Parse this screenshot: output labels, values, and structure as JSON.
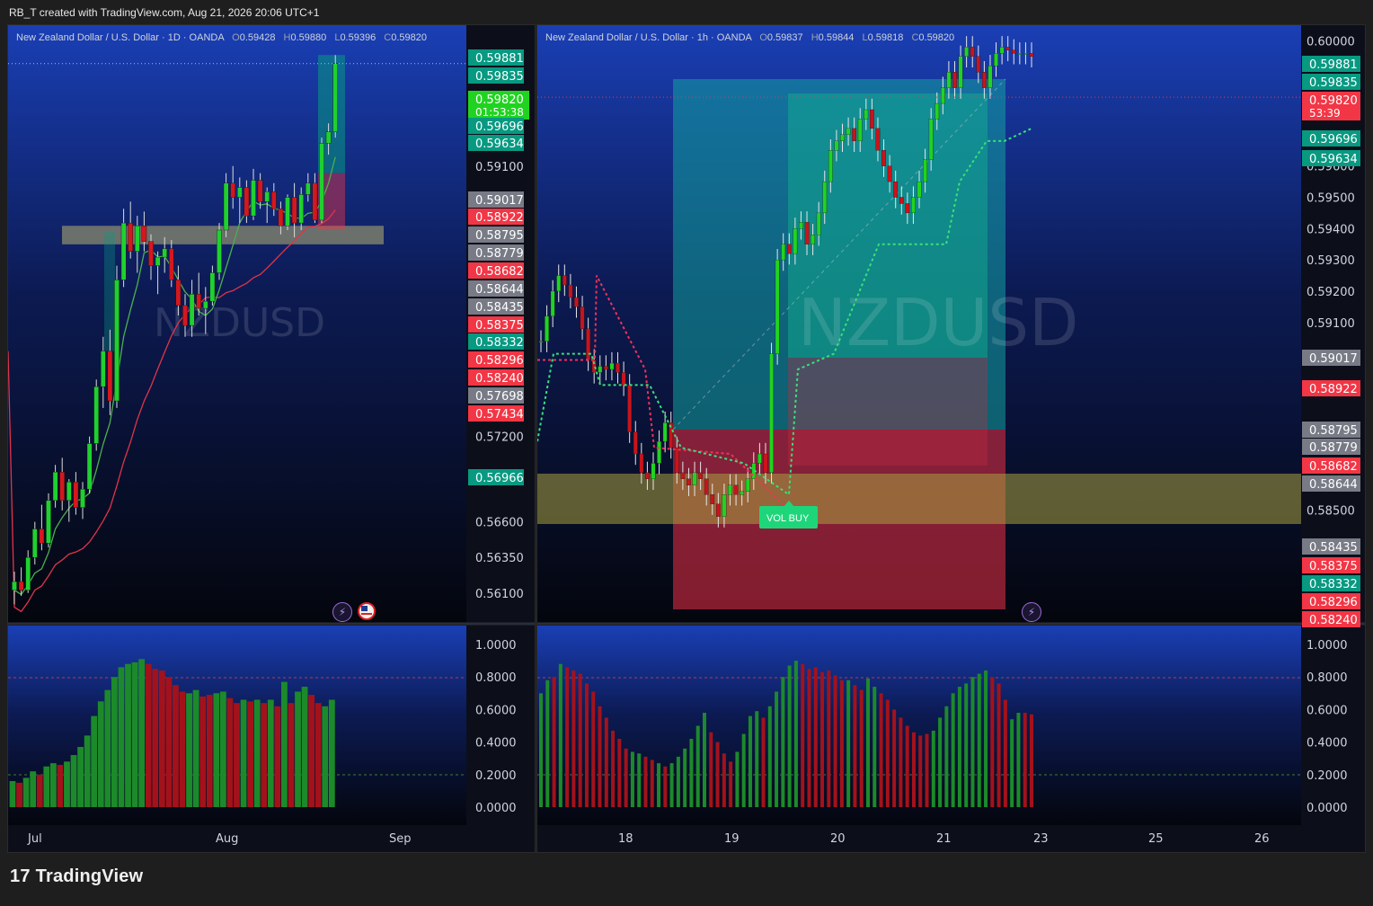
{
  "caption": "RB_T created with TradingView.com, Aug 21, 2026 20:06 UTC+1",
  "brand": {
    "name": "TradingView",
    "logo_icon": "tradingview-logo-icon"
  },
  "colors": {
    "up": "#1fd12f",
    "down": "#d5171e",
    "teal": "#089981",
    "red_label": "#f23645",
    "gray_label": "#787b86",
    "bg_top": "#1538a8",
    "bg_bottom": "#05070e"
  },
  "chart_data": [
    {
      "type": "candlestick",
      "pane": "left",
      "legend": {
        "symbol": "New Zealand Dollar / U.S. Dollar · 1D · OANDA",
        "o": "0.59428",
        "h": "0.59880",
        "l": "0.59396",
        "c": "0.59820"
      },
      "watermark": "NZDUSD",
      "ylim": [
        0.5589,
        0.6009
      ],
      "y_ticks": [
        "0.59100",
        "0.57200",
        "0.56600",
        "0.56350",
        "0.56100"
      ],
      "price_labels": [
        {
          "v": "0.59881",
          "kind": "teal"
        },
        {
          "v": "0.59835",
          "kind": "teal"
        },
        {
          "v": "0.59820",
          "kind": "current",
          "sub": "01:53:38"
        },
        {
          "v": "0.59696",
          "kind": "teal"
        },
        {
          "v": "0.59634",
          "kind": "teal"
        },
        {
          "v": "0.59017",
          "kind": "gray"
        },
        {
          "v": "0.58922",
          "kind": "red"
        },
        {
          "v": "0.58795",
          "kind": "gray"
        },
        {
          "v": "0.58779",
          "kind": "gray"
        },
        {
          "v": "0.58682",
          "kind": "red"
        },
        {
          "v": "0.58644",
          "kind": "gray"
        },
        {
          "v": "0.58435",
          "kind": "gray"
        },
        {
          "v": "0.58375",
          "kind": "red"
        },
        {
          "v": "0.58332",
          "kind": "teal"
        },
        {
          "v": "0.58296",
          "kind": "red"
        },
        {
          "v": "0.58240",
          "kind": "red"
        },
        {
          "v": "0.57698",
          "kind": "gray"
        },
        {
          "v": "0.57434",
          "kind": "red"
        },
        {
          "v": "0.56966",
          "kind": "teal"
        }
      ],
      "x_labels": [
        "Jul",
        "Aug",
        "Sep"
      ],
      "candles": [
        [
          0.5612,
          0.5625,
          0.5602,
          0.5618
        ],
        [
          0.5618,
          0.5628,
          0.5608,
          0.5612
        ],
        [
          0.5612,
          0.564,
          0.561,
          0.5635
        ],
        [
          0.5635,
          0.566,
          0.563,
          0.5655
        ],
        [
          0.5655,
          0.5672,
          0.564,
          0.5645
        ],
        [
          0.5645,
          0.568,
          0.5642,
          0.5675
        ],
        [
          0.5675,
          0.57,
          0.567,
          0.5695
        ],
        [
          0.5695,
          0.5705,
          0.5668,
          0.5675
        ],
        [
          0.5675,
          0.569,
          0.566,
          0.5688
        ],
        [
          0.5688,
          0.5695,
          0.5665,
          0.567
        ],
        [
          0.567,
          0.5688,
          0.5662,
          0.5683
        ],
        [
          0.5683,
          0.572,
          0.568,
          0.5715
        ],
        [
          0.5715,
          0.576,
          0.571,
          0.5755
        ],
        [
          0.5755,
          0.579,
          0.574,
          0.578
        ],
        [
          0.578,
          0.5795,
          0.5735,
          0.5745
        ],
        [
          0.5745,
          0.584,
          0.574,
          0.583
        ],
        [
          0.583,
          0.588,
          0.5825,
          0.587
        ],
        [
          0.587,
          0.5885,
          0.5845,
          0.585
        ],
        [
          0.585,
          0.5875,
          0.5835,
          0.5868
        ],
        [
          0.5868,
          0.5878,
          0.585,
          0.5857
        ],
        [
          0.5857,
          0.5862,
          0.583,
          0.584
        ],
        [
          0.584,
          0.585,
          0.582,
          0.5846
        ],
        [
          0.5846,
          0.586,
          0.5835,
          0.5852
        ],
        [
          0.5852,
          0.5858,
          0.5825,
          0.583
        ],
        [
          0.583,
          0.584,
          0.5805,
          0.5812
        ],
        [
          0.5812,
          0.582,
          0.579,
          0.5798
        ],
        [
          0.5798,
          0.583,
          0.579,
          0.582
        ],
        [
          0.582,
          0.5835,
          0.5805,
          0.581
        ],
        [
          0.581,
          0.5825,
          0.5792,
          0.5815
        ],
        [
          0.5815,
          0.584,
          0.5812,
          0.5835
        ],
        [
          0.5835,
          0.587,
          0.583,
          0.5865
        ],
        [
          0.5865,
          0.5905,
          0.586,
          0.5898
        ],
        [
          0.5898,
          0.591,
          0.588,
          0.5888
        ],
        [
          0.5888,
          0.5902,
          0.587,
          0.5895
        ],
        [
          0.5895,
          0.59,
          0.587,
          0.5875
        ],
        [
          0.5875,
          0.5908,
          0.5872,
          0.59
        ],
        [
          0.59,
          0.5905,
          0.588,
          0.5885
        ],
        [
          0.5885,
          0.5895,
          0.587,
          0.5892
        ],
        [
          0.5892,
          0.5898,
          0.5875,
          0.588
        ],
        [
          0.588,
          0.5885,
          0.5862,
          0.5868
        ],
        [
          0.5868,
          0.589,
          0.5865,
          0.5888
        ],
        [
          0.5888,
          0.5898,
          0.586,
          0.587
        ],
        [
          0.587,
          0.5895,
          0.5865,
          0.589
        ],
        [
          0.589,
          0.5905,
          0.5885,
          0.5898
        ],
        [
          0.5898,
          0.5905,
          0.587,
          0.5872
        ],
        [
          0.5872,
          0.593,
          0.587,
          0.5926
        ],
        [
          0.5926,
          0.594,
          0.5918,
          0.5934
        ],
        [
          0.5934,
          0.5988,
          0.593,
          0.5982
        ]
      ],
      "volume_ylim": [
        0,
        1.0
      ],
      "volume_ticks": [
        "1.0000",
        "0.8000",
        "0.6000",
        "0.4000",
        "0.2000",
        "0.0000"
      ],
      "volume": [
        [
          0.16,
          1
        ],
        [
          0.15,
          0
        ],
        [
          0.18,
          1
        ],
        [
          0.22,
          1
        ],
        [
          0.2,
          0
        ],
        [
          0.25,
          1
        ],
        [
          0.27,
          1
        ],
        [
          0.26,
          0
        ],
        [
          0.28,
          1
        ],
        [
          0.32,
          1
        ],
        [
          0.37,
          1
        ],
        [
          0.44,
          1
        ],
        [
          0.56,
          1
        ],
        [
          0.65,
          1
        ],
        [
          0.72,
          1
        ],
        [
          0.8,
          1
        ],
        [
          0.86,
          1
        ],
        [
          0.88,
          1
        ],
        [
          0.89,
          1
        ],
        [
          0.91,
          1
        ],
        [
          0.88,
          0
        ],
        [
          0.85,
          0
        ],
        [
          0.84,
          0
        ],
        [
          0.8,
          0
        ],
        [
          0.75,
          0
        ],
        [
          0.71,
          0
        ],
        [
          0.7,
          1
        ],
        [
          0.72,
          1
        ],
        [
          0.68,
          0
        ],
        [
          0.69,
          0
        ],
        [
          0.7,
          1
        ],
        [
          0.71,
          1
        ],
        [
          0.67,
          0
        ],
        [
          0.64,
          0
        ],
        [
          0.66,
          1
        ],
        [
          0.65,
          0
        ],
        [
          0.66,
          1
        ],
        [
          0.64,
          0
        ],
        [
          0.66,
          1
        ],
        [
          0.62,
          0
        ],
        [
          0.77,
          1
        ],
        [
          0.64,
          0
        ],
        [
          0.71,
          1
        ],
        [
          0.74,
          1
        ],
        [
          0.69,
          0
        ],
        [
          0.64,
          0
        ],
        [
          0.62,
          1
        ],
        [
          0.66,
          1
        ]
      ],
      "zone": {
        "lo": 0.5855,
        "hi": 0.5868
      },
      "annotations": {
        "tag_icon": "lightning-icon",
        "flag_icon": "us-flag-icon"
      }
    },
    {
      "type": "candlestick",
      "pane": "right",
      "legend": {
        "symbol": "New Zealand Dollar / U.S. Dollar · 1h · OANDA",
        "o": "0.59837",
        "h": "0.59844",
        "l": "0.59818",
        "c": "0.59820"
      },
      "watermark": "NZDUSD",
      "ylim": [
        0.5814,
        0.6005
      ],
      "y_ticks": [
        "0.60000",
        "0.59600",
        "0.59500",
        "0.59400",
        "0.59300",
        "0.59200",
        "0.59100",
        "0.58500"
      ],
      "price_labels": [
        {
          "v": "0.59881",
          "kind": "teal"
        },
        {
          "v": "0.59835",
          "kind": "teal"
        },
        {
          "v": "0.59820",
          "kind": "current_red",
          "sub": "53:39"
        },
        {
          "v": "0.59696",
          "kind": "teal"
        },
        {
          "v": "0.59634",
          "kind": "teal"
        },
        {
          "v": "0.59017",
          "kind": "gray"
        },
        {
          "v": "0.58922",
          "kind": "red"
        },
        {
          "v": "0.58795",
          "kind": "gray"
        },
        {
          "v": "0.58779",
          "kind": "gray"
        },
        {
          "v": "0.58682",
          "kind": "red"
        },
        {
          "v": "0.58644",
          "kind": "gray"
        },
        {
          "v": "0.58435",
          "kind": "gray"
        },
        {
          "v": "0.58375",
          "kind": "red"
        },
        {
          "v": "0.58332",
          "kind": "teal"
        },
        {
          "v": "0.58296",
          "kind": "red"
        },
        {
          "v": "0.58240",
          "kind": "red"
        }
      ],
      "x_labels": [
        "18",
        "19",
        "20",
        "21",
        "23",
        "25",
        "26"
      ],
      "signal_label": "VOL BUY",
      "price_path": [
        0.5904,
        0.5912,
        0.592,
        0.5925,
        0.5922,
        0.5918,
        0.5915,
        0.5908,
        0.5898,
        0.5894,
        0.5896,
        0.5895,
        0.5897,
        0.5894,
        0.589,
        0.5875,
        0.5868,
        0.5862,
        0.586,
        0.5865,
        0.5872,
        0.5878,
        0.587,
        0.5862,
        0.586,
        0.5858,
        0.5862,
        0.586,
        0.5855,
        0.5852,
        0.5848,
        0.5855,
        0.5858,
        0.5855,
        0.5856,
        0.586,
        0.5865,
        0.5868,
        0.5862,
        0.59,
        0.593,
        0.5935,
        0.5932,
        0.594,
        0.5942,
        0.5935,
        0.5938,
        0.5945,
        0.5955,
        0.5965,
        0.5968,
        0.597,
        0.5972,
        0.5968,
        0.5975,
        0.5978,
        0.5972,
        0.5965,
        0.596,
        0.5955,
        0.595,
        0.5948,
        0.5945,
        0.595,
        0.5955,
        0.5962,
        0.5975,
        0.598,
        0.5985,
        0.599,
        0.5985,
        0.5995,
        0.5998,
        0.5995,
        0.599,
        0.5985,
        0.5992,
        0.5996,
        0.5998,
        0.5997,
        0.5996,
        0.5996,
        0.5996,
        0.5995
      ],
      "volume_ylim": [
        0,
        1.0
      ],
      "volume_ticks": [
        "1.0000",
        "0.8000",
        "0.6000",
        "0.4000",
        "0.2000",
        "0.0000"
      ],
      "volume": [
        [
          0.7,
          1
        ],
        [
          0.78,
          1
        ],
        [
          0.8,
          0
        ],
        [
          0.88,
          1
        ],
        [
          0.86,
          0
        ],
        [
          0.84,
          0
        ],
        [
          0.82,
          0
        ],
        [
          0.76,
          0
        ],
        [
          0.71,
          0
        ],
        [
          0.62,
          0
        ],
        [
          0.55,
          0
        ],
        [
          0.47,
          0
        ],
        [
          0.42,
          0
        ],
        [
          0.36,
          0
        ],
        [
          0.34,
          1
        ],
        [
          0.33,
          1
        ],
        [
          0.31,
          0
        ],
        [
          0.29,
          0
        ],
        [
          0.27,
          1
        ],
        [
          0.25,
          0
        ],
        [
          0.27,
          1
        ],
        [
          0.31,
          1
        ],
        [
          0.36,
          1
        ],
        [
          0.42,
          1
        ],
        [
          0.5,
          1
        ],
        [
          0.58,
          1
        ],
        [
          0.46,
          0
        ],
        [
          0.4,
          0
        ],
        [
          0.33,
          0
        ],
        [
          0.28,
          0
        ],
        [
          0.34,
          1
        ],
        [
          0.45,
          1
        ],
        [
          0.56,
          1
        ],
        [
          0.59,
          1
        ],
        [
          0.55,
          0
        ],
        [
          0.62,
          1
        ],
        [
          0.71,
          1
        ],
        [
          0.8,
          1
        ],
        [
          0.87,
          1
        ],
        [
          0.9,
          1
        ],
        [
          0.88,
          0
        ],
        [
          0.85,
          0
        ],
        [
          0.86,
          0
        ],
        [
          0.83,
          0
        ],
        [
          0.84,
          0
        ],
        [
          0.81,
          0
        ],
        [
          0.78,
          0
        ],
        [
          0.78,
          1
        ],
        [
          0.75,
          0
        ],
        [
          0.72,
          0
        ],
        [
          0.79,
          1
        ],
        [
          0.74,
          1
        ],
        [
          0.7,
          0
        ],
        [
          0.66,
          0
        ],
        [
          0.6,
          0
        ],
        [
          0.55,
          0
        ],
        [
          0.5,
          0
        ],
        [
          0.46,
          0
        ],
        [
          0.44,
          0
        ],
        [
          0.45,
          0
        ],
        [
          0.47,
          1
        ],
        [
          0.55,
          1
        ],
        [
          0.62,
          1
        ],
        [
          0.7,
          1
        ],
        [
          0.74,
          1
        ],
        [
          0.76,
          1
        ],
        [
          0.8,
          1
        ],
        [
          0.82,
          1
        ],
        [
          0.84,
          1
        ],
        [
          0.8,
          0
        ],
        [
          0.76,
          0
        ],
        [
          0.66,
          0
        ],
        [
          0.54,
          1
        ],
        [
          0.58,
          1
        ],
        [
          0.58,
          0
        ],
        [
          0.57,
          0
        ]
      ],
      "annotations": {
        "tag_icon": "lightning-icon"
      }
    }
  ]
}
